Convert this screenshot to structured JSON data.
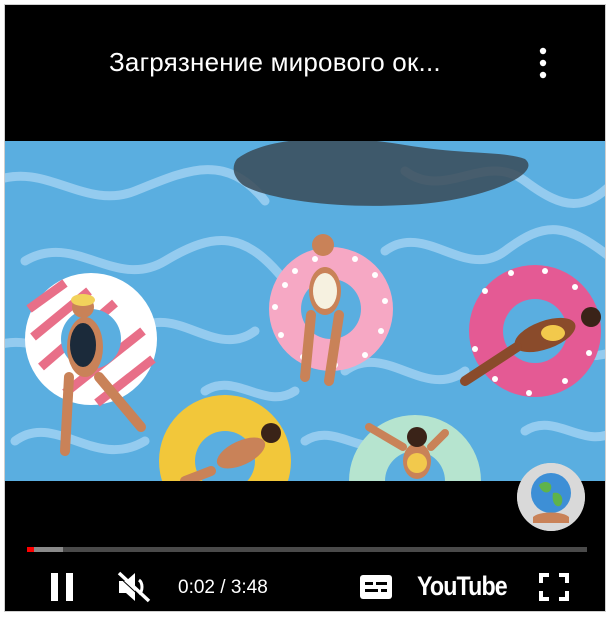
{
  "player": {
    "title": "Загрязнение мирового ок...",
    "time": {
      "current": "0:02",
      "separator": " / ",
      "duration": "3:48"
    },
    "progress": {
      "played_fraction": 0.012,
      "buffered_fraction": 0.065
    },
    "brand": "YouTube",
    "icons": {
      "menu": "more-vert-icon",
      "pause": "pause-icon",
      "volume": "volume-muted-icon",
      "captions": "subtitles-icon",
      "fullscreen": "fullscreen-icon",
      "channel": "globe-avatar"
    },
    "colors": {
      "progress_played": "#ff0000",
      "water": "#5aaee0",
      "background": "#000000"
    }
  }
}
